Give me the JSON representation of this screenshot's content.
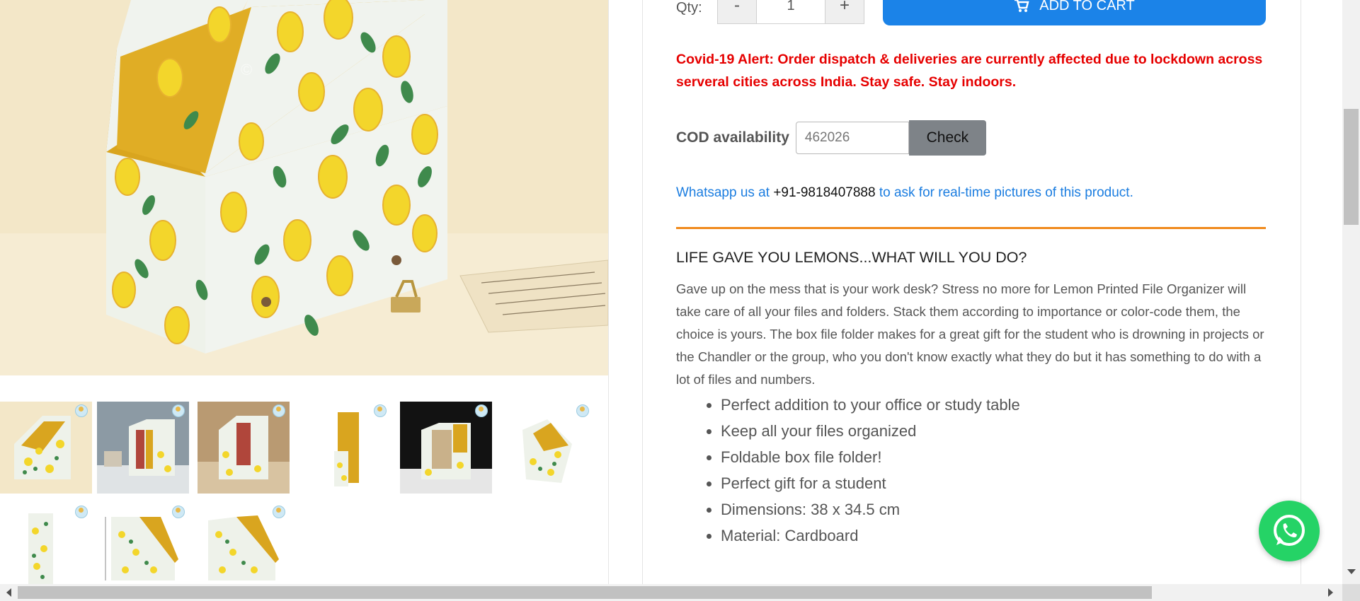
{
  "product": {
    "watermark": "©"
  },
  "purchase": {
    "qty_label": "Qty:",
    "qty_minus": "-",
    "qty_value": "1",
    "qty_plus": "+",
    "add_to_cart": "ADD TO CART"
  },
  "alert": {
    "text": "Covid-19 Alert: Order dispatch & deliveries are currently affected due to lockdown across serveral cities across India. Stay safe. Stay indoors."
  },
  "cod": {
    "label": "COD availability",
    "pincode_value": "462026",
    "check_label": "Check"
  },
  "whatsapp_line": {
    "prefix": "Whatsapp us at",
    "phone": "+91-9818407888",
    "suffix": "to ask for real-time pictures of this product."
  },
  "description": {
    "title": "LIFE GAVE YOU LEMONS...WHAT WILL YOU DO?",
    "body": "Gave up on the mess that is your work desk? Stress no more for Lemon Printed File Organizer will take care of all your files and folders. Stack them according to importance or color-code them, the choice is yours. The box file folder makes for a great gift for the student who is drowning in projects or the Chandler or the group, who you don't know exactly what they do but it has something to do with a lot of files and numbers.",
    "features": [
      "Perfect addition to your office or study table",
      "Keep all your files organized",
      "Foldable box file folder!",
      "Perfect gift for a student",
      "Dimensions: 38 x 34.5 cm",
      "Material: Cardboard"
    ]
  },
  "colors": {
    "accent_blue": "#1b83e8",
    "alert_red": "#e60000",
    "rule_orange": "#f08a1c",
    "whatsapp_green": "#25d366"
  },
  "icons": [
    "cart-icon",
    "whatsapp-icon"
  ]
}
